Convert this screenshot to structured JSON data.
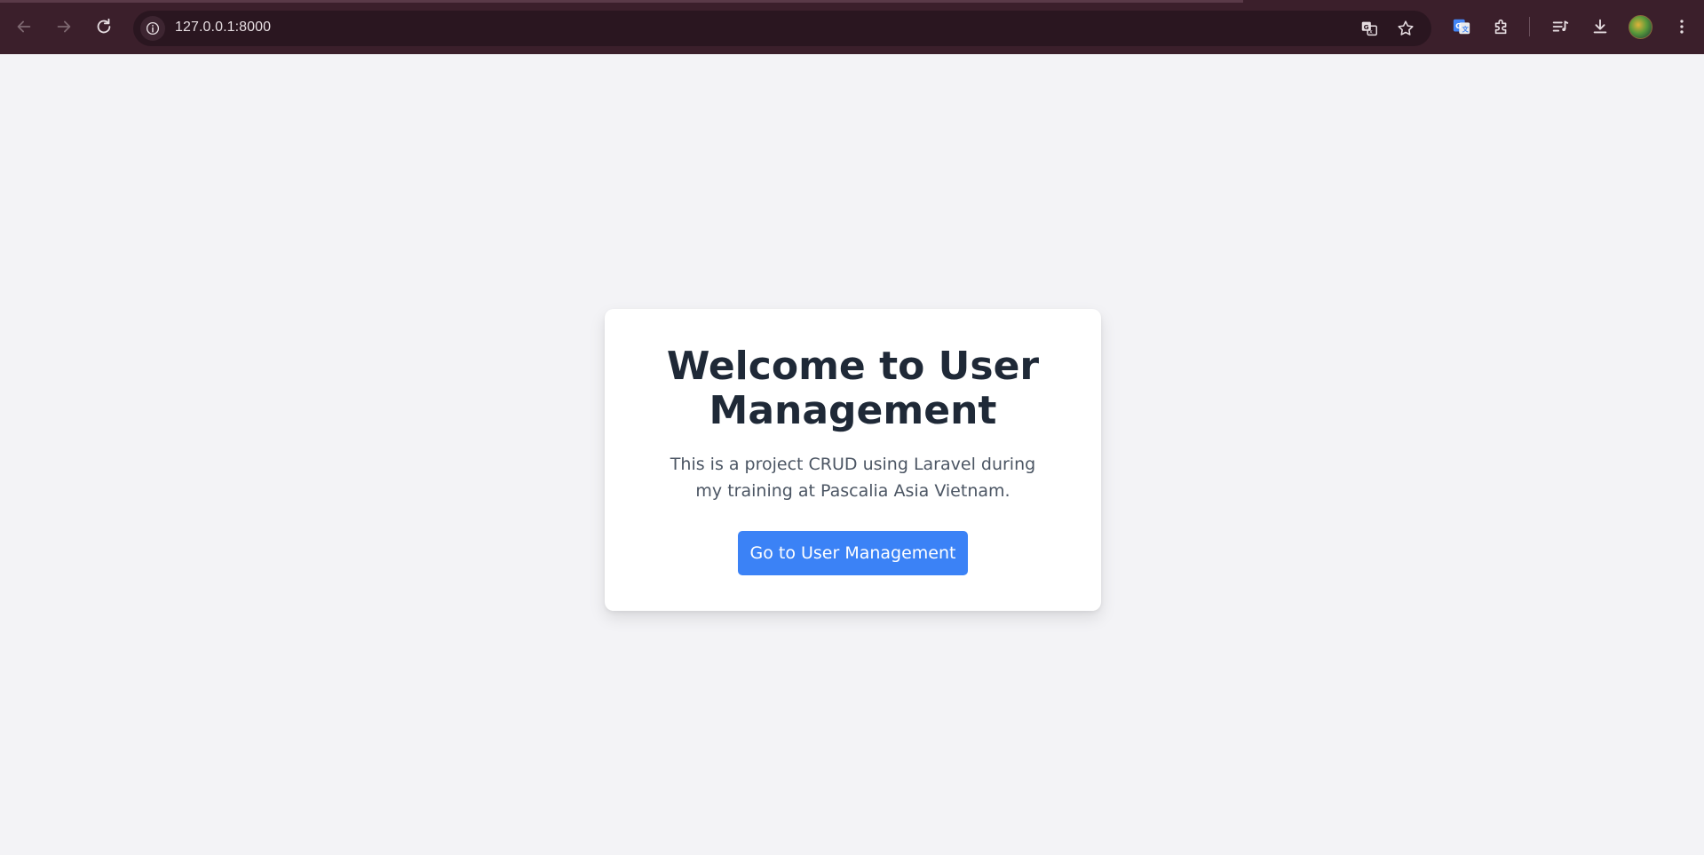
{
  "browser": {
    "url": "127.0.0.1:8000",
    "icons": [
      "back-icon",
      "forward-icon",
      "reload-icon",
      "site-info-icon",
      "translate-icon",
      "bookmark-star-icon",
      "google-translate-extension-icon",
      "extensions-icon",
      "media-controls-icon",
      "downloads-icon",
      "profile-avatar",
      "more-menu-icon"
    ]
  },
  "page": {
    "title": "Welcome to User Management",
    "description": "This is a project CRUD using Laravel during my training at Pascalia Asia Vietnam.",
    "button_label": "Go to User Management"
  },
  "colors": {
    "toolbar": "#3b1f2b",
    "page_background": "#f3f3f6",
    "card": "#ffffff",
    "title": "#1f2937",
    "text": "#4b5563",
    "button": "#3b82f6"
  }
}
